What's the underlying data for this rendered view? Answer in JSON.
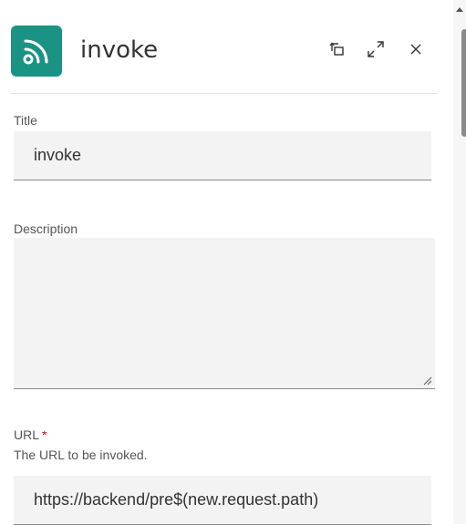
{
  "header": {
    "title": "invoke",
    "icon": "rss-feed-icon",
    "icon_color": "#1a9384",
    "actions": [
      "restore-icon",
      "expand-icon",
      "close-icon"
    ],
    "close_glyph": "×"
  },
  "form": {
    "title": {
      "label": "Title",
      "value": "invoke"
    },
    "description": {
      "label": "Description",
      "value": ""
    },
    "url": {
      "label": "URL",
      "required_mark": "*",
      "hint": "The URL to be invoked.",
      "value": "https://backend/pre$(new.request.path)"
    }
  },
  "colors": {
    "accent": "#1a9384",
    "required": "#d0021b",
    "field_bg": "#f3f3f3"
  }
}
